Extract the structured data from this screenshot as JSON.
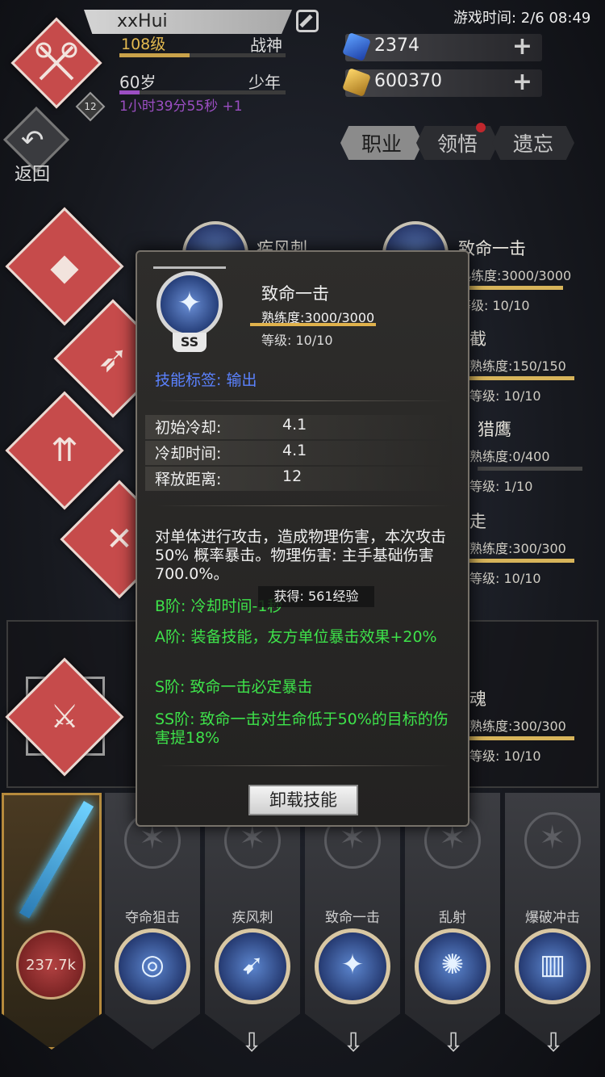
{
  "player": {
    "name": "xxHui",
    "level": "108级",
    "title": "战神",
    "level_progress": 0.42,
    "age": "60岁",
    "stage": "少年",
    "age_progress": 0.12,
    "timer": "1小时39分55秒 +1",
    "avatar_badge": "12"
  },
  "game_time": "游戏时间: 2/6 08:49",
  "currency": {
    "gems": "2374",
    "gold": "600370"
  },
  "back_label": "返回",
  "tabs": [
    "职业",
    "领悟",
    "遗忘"
  ],
  "tree_skills": [
    {
      "name": "疾风刺"
    },
    {
      "name": "致命一击",
      "prof": "熟练度:3000/3000",
      "lvl": "等级: 10/10",
      "fill": 1.0
    },
    {
      "name": "截",
      "prof": "熟练度:150/150",
      "lvl": "等级: 10/10",
      "fill": 1.0
    },
    {
      "name": "猎鹰",
      "prof": "熟练度:0/400",
      "lvl": "等级: 1/10",
      "fill": 0.0
    },
    {
      "name": "走",
      "prof": "熟练度:300/300",
      "lvl": "等级: 10/10",
      "fill": 1.0
    },
    {
      "name": "魂",
      "prof": "熟练度:300/300",
      "lvl": "等级: 10/10",
      "fill": 1.0
    }
  ],
  "popup": {
    "skill_name": "致命一击",
    "grade": "SS",
    "proficiency": "熟练度:3000/3000",
    "level": "等级: 10/10",
    "tag": "技能标签: 输出",
    "stats": [
      {
        "key": "初始冷却:",
        "value": "4.1"
      },
      {
        "key": "冷却时间:",
        "value": "4.1"
      },
      {
        "key": "释放距离:",
        "value": "12"
      }
    ],
    "description": "对单体进行攻击，造成物理伤害，本次攻击 50% 概率暴击。物理伤害: 主手基础伤害700.0%。",
    "tiers": [
      "B阶: 冷却时间-1秒",
      "A阶: 装备技能，友方单位暴击效果+20%",
      "S阶: 致命一击必定暴击",
      "SS阶: 致命一击对生命低于50%的目标的伤害提18%"
    ],
    "unload_label": "卸载技能"
  },
  "exp_toast": "获得: 561经验",
  "weapon_power": "237.7k",
  "slots": [
    "夺命狙击",
    "疾风刺",
    "致命一击",
    "乱射",
    "爆破冲击"
  ],
  "colors": {
    "accent_red": "#c64b4b",
    "gold": "#e3b94f",
    "green_text": "#3ee24a",
    "tag_blue": "#5b82ff"
  }
}
